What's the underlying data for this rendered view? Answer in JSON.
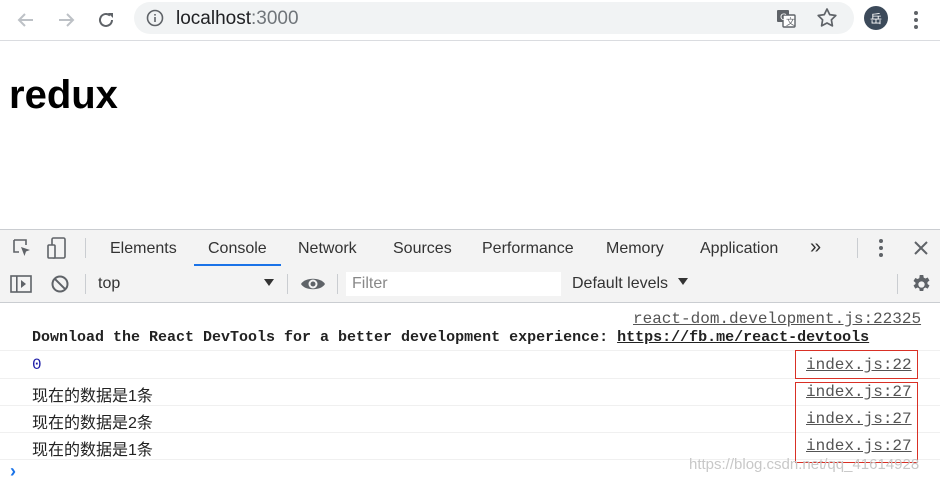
{
  "browser": {
    "url_host": "localhost",
    "url_port": ":3000",
    "avatar_text": "岳",
    "icons": [
      "back-arrow-icon",
      "forward-arrow-icon",
      "reload-icon",
      "info-icon",
      "translate-icon",
      "star-icon",
      "more-vert-icon"
    ]
  },
  "page": {
    "title": "redux"
  },
  "devtools": {
    "tabs": [
      {
        "label": "Elements"
      },
      {
        "label": "Console"
      },
      {
        "label": "Network"
      },
      {
        "label": "Sources"
      },
      {
        "label": "Performance"
      },
      {
        "label": "Memory"
      },
      {
        "label": "Application"
      }
    ],
    "overflow_label": "»",
    "active_tab": "Console",
    "accent_color": "#1a73e8",
    "console_toolbar": {
      "context": "top",
      "filter_placeholder": "Filter",
      "levels": "Default levels"
    },
    "messages": [
      {
        "source": "react-dom.development.js:22325",
        "text": "Download the React DevTools for a better development experience: ",
        "link": "https://fb.me/react-devtools"
      },
      {
        "text": "0",
        "source": "index.js:22"
      },
      {
        "text": "现在的数据是1条",
        "source": "index.js:27"
      },
      {
        "text": "现在的数据是2条",
        "source": "index.js:27"
      },
      {
        "text": "现在的数据是1条",
        "source": "index.js:27"
      }
    ],
    "prompt": "›",
    "highlight_color": "#d93025"
  },
  "watermark": "https://blog.csdn.net/qq_41614928"
}
